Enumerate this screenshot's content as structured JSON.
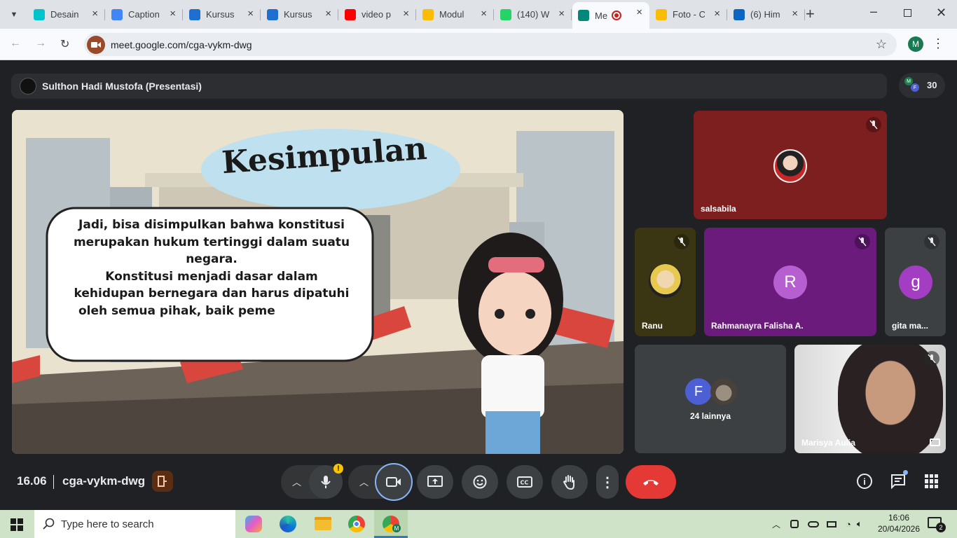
{
  "browser": {
    "tabs": [
      {
        "title": "Desain",
        "icon": "canva-icon",
        "color": "#00c4cc"
      },
      {
        "title": "Caption",
        "icon": "gemini-icon",
        "color": "#4285f4"
      },
      {
        "title": "Kursus",
        "icon": "course-icon",
        "color": "#1f6fd1"
      },
      {
        "title": "Kursus",
        "icon": "course-icon",
        "color": "#1f6fd1"
      },
      {
        "title": "video p",
        "icon": "youtube-icon",
        "color": "#ff0000"
      },
      {
        "title": "Modul",
        "icon": "drive-icon",
        "color": "#fbbc04"
      },
      {
        "title": "(140) W",
        "icon": "whatsapp-icon",
        "color": "#25d366"
      },
      {
        "title": "Me",
        "icon": "meet-icon",
        "color": "#00897b"
      },
      {
        "title": "Foto - C",
        "icon": "drive-icon",
        "color": "#fbbc04"
      },
      {
        "title": "(6) Him",
        "icon": "linkedin-icon",
        "color": "#0a66c2"
      }
    ],
    "url": "meet.google.com/cga-vykm-dwg",
    "profile_initial": "M"
  },
  "meet": {
    "presenter": "Sulthon Hadi Mustofa (Presentasi)",
    "participant_count": "30",
    "people_initials": [
      "M",
      "F"
    ],
    "slide": {
      "title": "Kesimpulan",
      "text_lines": [
        "Jadi, bisa disimpulkan bahwa konstitusi",
        "merupakan hukum tertinggi dalam suatu",
        "negara.",
        "Konstitusi menjadi dasar dalam",
        "kehidupan bernegara dan harus dipatuhi",
        "oleh semua pihak, baik peme"
      ]
    },
    "tiles": [
      {
        "name": "salsabila"
      },
      {
        "name": "Ranu"
      },
      {
        "name": "Rahmanayra Falisha A.",
        "initial": "R"
      },
      {
        "name": "gita ma...",
        "initial": "g"
      },
      {
        "name": "24 lainnya",
        "initial": "F"
      },
      {
        "name": "Marisya Aulia"
      }
    ],
    "time": "16.06",
    "meeting_code": "cga-vykm-dwg"
  },
  "taskbar": {
    "search_placeholder": "Type here to search",
    "clock_time": "16:06",
    "clock_date": "20/04/2026",
    "notification_count": "2"
  },
  "colors": {
    "hangup": "#e53935",
    "meet_bg": "#202124",
    "salsabila_bg": "#7d1f1f",
    "rahmanayra_bg": "#6a1b7c",
    "r_avatar": "#b65fd1",
    "g_avatar": "#a33ec2",
    "f_avatar": "#4c5fd5"
  }
}
